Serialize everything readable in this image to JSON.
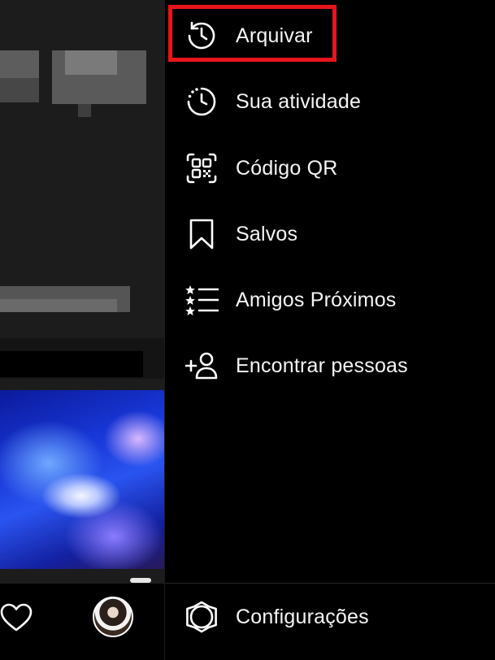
{
  "menu": {
    "items": [
      {
        "label": "Arquivar",
        "icon": "archive-history-icon",
        "highlighted": true
      },
      {
        "label": "Sua atividade",
        "icon": "activity-icon"
      },
      {
        "label": "Código QR",
        "icon": "qr-code-icon"
      },
      {
        "label": "Salvos",
        "icon": "bookmark-icon"
      },
      {
        "label": "Amigos Próximos",
        "icon": "close-friends-icon"
      },
      {
        "label": "Encontrar pessoas",
        "icon": "add-person-icon"
      }
    ],
    "settings": {
      "label": "Configurações",
      "icon": "settings-gear-icon"
    }
  },
  "colors": {
    "highlight": "#e8141b",
    "drawer_bg": "#000000",
    "text": "#f5f5f5"
  }
}
